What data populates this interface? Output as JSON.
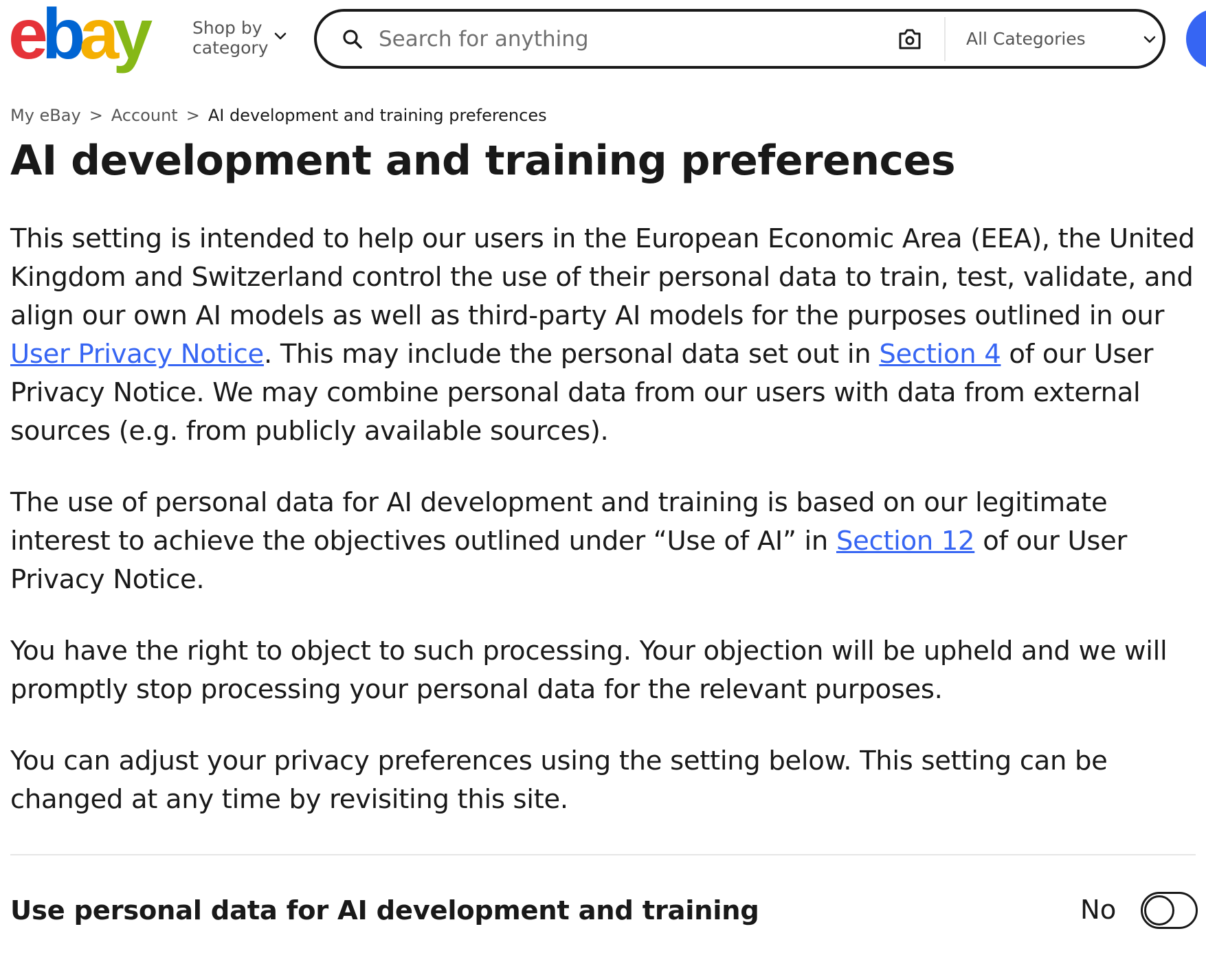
{
  "header": {
    "logo": {
      "letters": [
        "e",
        "b",
        "a",
        "y"
      ],
      "colors": [
        "#e53238",
        "#0064d2",
        "#f5af02",
        "#86b817"
      ]
    },
    "shop_by": {
      "line1": "Shop by",
      "line2": "category"
    },
    "search": {
      "placeholder": "Search for anything",
      "value": ""
    },
    "category_select": {
      "selected": "All Categories"
    },
    "accent_color": "#3665f3"
  },
  "breadcrumb": {
    "items": [
      "My eBay",
      "Account",
      "AI development and training preferences"
    ],
    "separator": ">"
  },
  "page": {
    "title": "AI development and training preferences",
    "para1": {
      "t1": "This setting is intended to help our users in the European Economic Area (EEA), the United Kingdom and Switzerland control the use of their personal data to train, test, validate, and align our own AI models as well as third-party AI models for the purposes outlined in our ",
      "link1": "User Privacy Notice",
      "t2": ". This may include the personal data set out in ",
      "link2": "Section 4",
      "t3": " of our User Privacy Notice. We may combine personal data from our users with data from external sources (e.g. from publicly available sources)."
    },
    "para2": {
      "t1": "The use of personal data for AI development and training is based on our legitimate interest to achieve the objectives outlined under “Use of AI” in ",
      "link1": "Section 12",
      "t2": " of our User Privacy Notice."
    },
    "para3": "You have the right to object to such processing. Your objection will be upheld and we will promptly stop processing your personal data for the relevant purposes.",
    "para4": "You can adjust your privacy preferences using the setting below. This setting can be changed at any time by revisiting this site."
  },
  "setting": {
    "label": "Use personal data for AI development and training",
    "state_text": "No",
    "enabled": false
  }
}
